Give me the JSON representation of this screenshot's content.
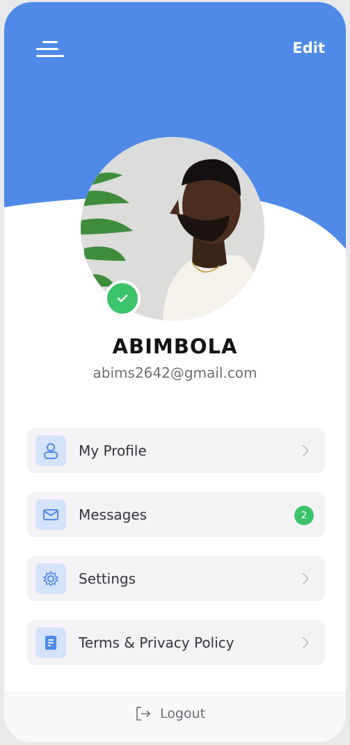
{
  "header": {
    "edit_label": "Edit",
    "accent_color": "#4f8ae8"
  },
  "profile": {
    "name": "ABIMBOLA",
    "email": "abims2642@gmail.com",
    "verified_icon": "check-icon"
  },
  "menu": {
    "items": [
      {
        "label": "My Profile",
        "icon": "user-icon"
      },
      {
        "label": "Messages",
        "icon": "mail-icon",
        "badge": "2"
      },
      {
        "label": "Settings",
        "icon": "gear-icon"
      },
      {
        "label": "Terms & Privacy Policy",
        "icon": "document-icon"
      }
    ]
  },
  "footer": {
    "logout_label": "Logout",
    "logout_icon": "logout-icon"
  }
}
